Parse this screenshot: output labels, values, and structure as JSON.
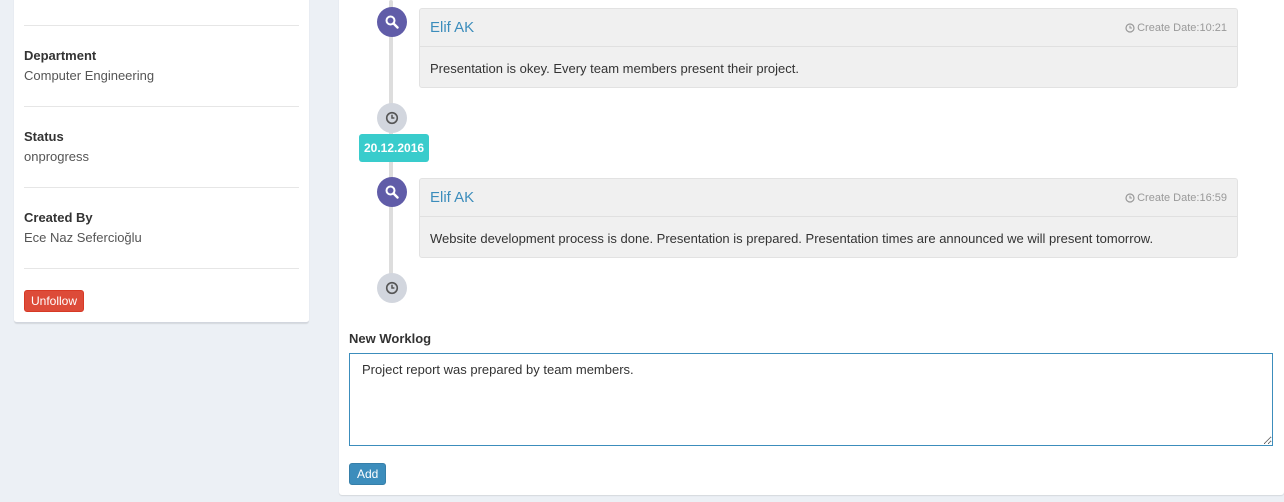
{
  "sidebar": {
    "department_label": "Department",
    "department_value": "Computer Engineering",
    "status_label": "Status",
    "status_value": "onprogress",
    "created_by_label": "Created By",
    "created_by_value": "Ece Naz Sefercioğlu",
    "unfollow_label": "Unfollow"
  },
  "timeline": {
    "date_label": "20.12.2016",
    "entries": [
      {
        "author": "Elif AK",
        "time": "Create Date:10:21",
        "body": "Presentation is okey. Every team members present their project."
      },
      {
        "author": "Elif AK",
        "time": "Create Date:16:59",
        "body": "Website development process is done. Presentation is prepared. Presentation times are announced we will present tomorrow."
      }
    ]
  },
  "worklog": {
    "label": "New Worklog",
    "value": "Project report was prepared by team members.",
    "add_label": "Add"
  },
  "colors": {
    "accent": "#3c8dbc",
    "danger": "#dd4b39",
    "timeline_icon": "#605ca8",
    "date_badge": "#39cccc"
  },
  "icons": {
    "entry_icon": "search-icon",
    "end_icon": "clock-icon",
    "time_icon": "clock-icon"
  }
}
